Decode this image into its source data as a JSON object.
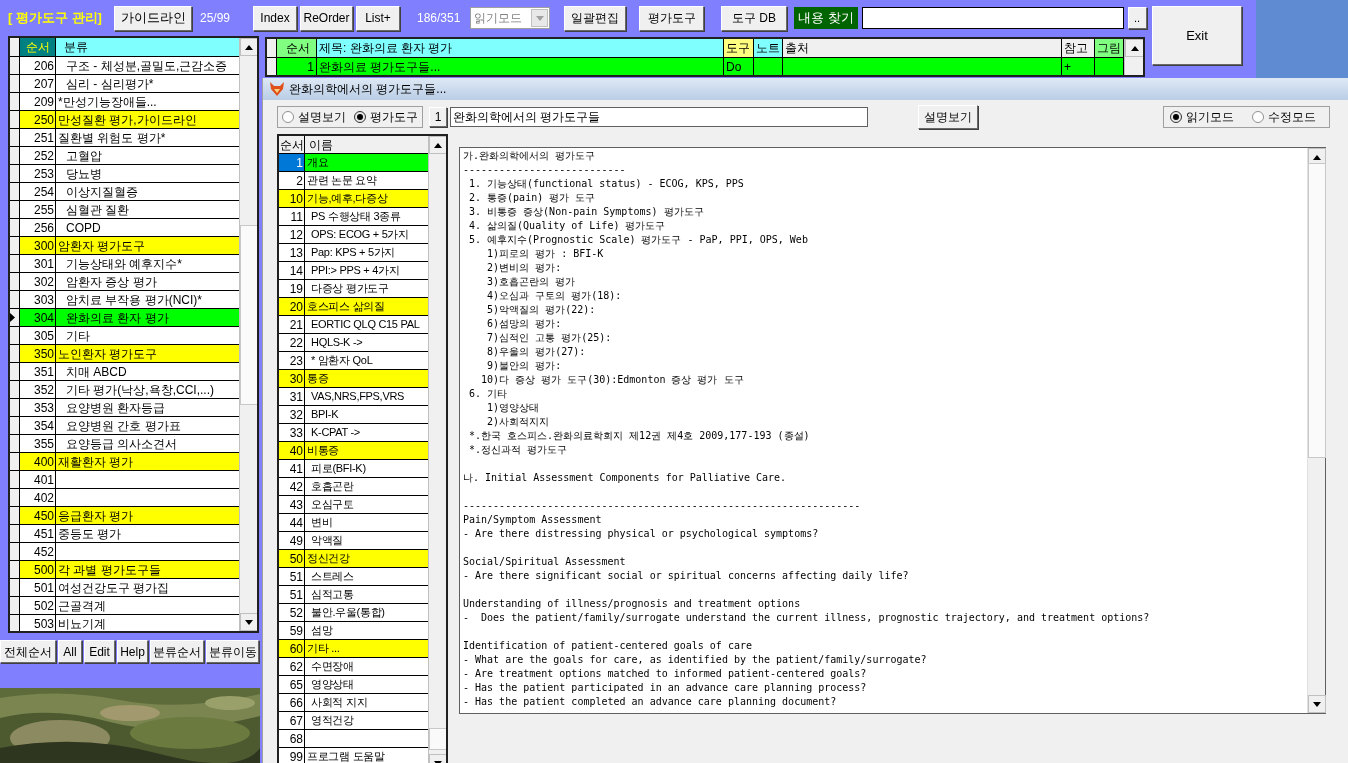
{
  "main_window": {
    "title": "[ 평가도구 관리]",
    "guideline_button": "가이드라인",
    "tool_counter": "25/99",
    "toolbar_buttons": [
      "Index",
      "ReOrder",
      "List+"
    ],
    "record_counter": "186/351",
    "mode_combo": {
      "value": "읽기모드",
      "disabled": true
    },
    "action_buttons": [
      "일괄편집",
      "평가도구",
      "도구 DB"
    ],
    "search": {
      "label": "내용 찾기"
    },
    "search_more_button": "..",
    "exit_button": "Exit"
  },
  "category_list": {
    "columns": [
      "순서",
      "분류"
    ],
    "rows": [
      {
        "order": "206",
        "label": "구조 - 체성분,골밀도,근감소증",
        "kind": "subitem",
        "selected": false
      },
      {
        "order": "207",
        "label": "심리 - 심리평가*",
        "kind": "subitem",
        "selected": false
      },
      {
        "order": "209",
        "label": "*만성기능장애들...",
        "kind": "item",
        "selected": false
      },
      {
        "order": "250",
        "label": "만성질환 평가,가이드라인",
        "kind": "group",
        "selected": false
      },
      {
        "order": "251",
        "label": "질환별 위험도 평가*",
        "kind": "item",
        "selected": false
      },
      {
        "order": "252",
        "label": "고혈압",
        "kind": "subitem",
        "selected": false
      },
      {
        "order": "253",
        "label": "당뇨병",
        "kind": "subitem",
        "selected": false
      },
      {
        "order": "254",
        "label": "이상지질혈증",
        "kind": "subitem",
        "selected": false
      },
      {
        "order": "255",
        "label": "심혈관 질환",
        "kind": "subitem",
        "selected": false
      },
      {
        "order": "256",
        "label": "COPD",
        "kind": "subitem",
        "selected": false
      },
      {
        "order": "300",
        "label": "암환자 평가도구",
        "kind": "group",
        "selected": false
      },
      {
        "order": "301",
        "label": "기능상태와 예후지수*",
        "kind": "subitem",
        "selected": false
      },
      {
        "order": "302",
        "label": "암환자 증상 평가",
        "kind": "subitem",
        "selected": false
      },
      {
        "order": "303",
        "label": "암치료 부작용 평가(NCI)*",
        "kind": "subitem",
        "selected": false
      },
      {
        "order": "304",
        "label": "완화의료 환자 평가",
        "kind": "subitem",
        "selected": true
      },
      {
        "order": "305",
        "label": "기타",
        "kind": "subitem",
        "selected": false
      },
      {
        "order": "350",
        "label": "노인환자 평가도구",
        "kind": "group",
        "selected": false
      },
      {
        "order": "351",
        "label": "치매 ABCD",
        "kind": "subitem",
        "selected": false
      },
      {
        "order": "352",
        "label": "기타 평가(낙상,욕창,CCI,...)",
        "kind": "subitem",
        "selected": false
      },
      {
        "order": "353",
        "label": "요양병원 환자등급",
        "kind": "subitem",
        "selected": false
      },
      {
        "order": "354",
        "label": "요양병원 간호 평가표",
        "kind": "subitem",
        "selected": false
      },
      {
        "order": "355",
        "label": "요양등급 의사소견서",
        "kind": "subitem",
        "selected": false
      },
      {
        "order": "400",
        "label": "재활환자 평가",
        "kind": "group",
        "selected": false
      },
      {
        "order": "401",
        "kind": "item",
        "selected": false
      },
      {
        "order": "402",
        "kind": "item",
        "selected": false
      },
      {
        "order": "450",
        "label": "응급환자 평가",
        "kind": "group",
        "selected": false
      },
      {
        "order": "451",
        "label": "중등도 평가",
        "kind": "item",
        "selected": false
      },
      {
        "order": "452",
        "kind": "item",
        "selected": false
      },
      {
        "order": "500",
        "label": "각 과별 평가도구들",
        "kind": "group",
        "selected": false
      },
      {
        "order": "501",
        "label": "여성건강도구 평가집",
        "kind": "item",
        "selected": false
      },
      {
        "order": "502",
        "label": "근골격계",
        "kind": "item",
        "selected": false
      },
      {
        "order": "503",
        "label": "비뇨기계",
        "kind": "item",
        "selected": false
      }
    ]
  },
  "bottom_buttons": [
    "전체순서",
    "All",
    "Edit",
    "Help",
    "분류순서",
    "분류이동"
  ],
  "background_photo": {
    "kind": "picture"
  },
  "record_grid": {
    "columns": [
      {
        "label": "순서",
        "color": "#80ff80"
      },
      {
        "label": "제목: 완화의료 환자 평가",
        "color": "#80ffff"
      },
      {
        "label": "도구",
        "color": "#ffff80"
      },
      {
        "label": "노트",
        "color": "#80ffff"
      },
      {
        "label": "출처",
        "color": "#f0f0f0"
      },
      {
        "label": "참고",
        "color": "#f0f0f0"
      },
      {
        "label": "그림",
        "color": "#80ff80"
      }
    ],
    "rows": [
      {
        "order": "1",
        "title": "완화의료 평가도구들...",
        "tool": "Do",
        "reference": "+",
        "selected": true
      }
    ]
  },
  "dialog": {
    "title": "완화의학에서의 평가도구들...",
    "view_radios": [
      {
        "label": "설명보기",
        "selected": false
      },
      {
        "label": "평가도구",
        "selected": true
      }
    ],
    "page_button": "1",
    "title_field": "완화의학에서의 평가도구들",
    "explain_button": "설명보기",
    "mode_radios": [
      {
        "label": "읽기모드",
        "selected": true
      },
      {
        "label": "수정모드",
        "selected": false
      }
    ],
    "item_list": {
      "columns": [
        "순서",
        "이름"
      ],
      "rows": [
        {
          "order": "1",
          "label": "개요",
          "kind": "item",
          "selected": true
        },
        {
          "order": "2",
          "label": "관련 논문 요약",
          "kind": "item",
          "selected": false
        },
        {
          "order": "10",
          "label": "기능,예후,다증상",
          "kind": "group",
          "selected": false
        },
        {
          "order": "11",
          "label": "PS 수행상태 3종류",
          "kind": "subitem",
          "selected": false
        },
        {
          "order": "12",
          "label": "OPS: ECOG + 5가지",
          "kind": "subitem",
          "selected": false
        },
        {
          "order": "13",
          "label": "Pap: KPS + 5가지",
          "kind": "subitem",
          "selected": false
        },
        {
          "order": "14",
          "label": "PPI:> PPS + 4가지",
          "kind": "subitem",
          "selected": false
        },
        {
          "order": "19",
          "label": "다증상 평가도구",
          "kind": "subitem",
          "selected": false
        },
        {
          "order": "20",
          "label": "호스피스 삶의질",
          "kind": "group",
          "selected": false
        },
        {
          "order": "21",
          "label": "EORTIC QLQ C15 PAL",
          "kind": "subitem",
          "selected": false
        },
        {
          "order": "22",
          "label": "HQLS-K ->",
          "kind": "subitem",
          "selected": false
        },
        {
          "order": "23",
          "label": "* 암환자 QoL",
          "kind": "subitem",
          "selected": false
        },
        {
          "order": "30",
          "label": "통증",
          "kind": "group",
          "selected": false
        },
        {
          "order": "31",
          "label": "VAS,NRS,FPS,VRS",
          "kind": "subitem",
          "selected": false
        },
        {
          "order": "32",
          "label": "BPI-K",
          "kind": "subitem",
          "selected": false
        },
        {
          "order": "33",
          "label": "K-CPAT ->",
          "kind": "subitem",
          "selected": false
        },
        {
          "order": "40",
          "label": "비통증",
          "kind": "group",
          "selected": false
        },
        {
          "order": "41",
          "label": "피로(BFI-K)",
          "kind": "subitem",
          "selected": false
        },
        {
          "order": "42",
          "label": "호흡곤란",
          "kind": "subitem",
          "selected": false
        },
        {
          "order": "43",
          "label": "오심구토",
          "kind": "subitem",
          "selected": false
        },
        {
          "order": "44",
          "label": "변비",
          "kind": "subitem",
          "selected": false
        },
        {
          "order": "49",
          "label": "악액질",
          "kind": "subitem",
          "selected": false
        },
        {
          "order": "50",
          "label": "정신건강",
          "kind": "group",
          "selected": false
        },
        {
          "order": "51",
          "label": "스트레스",
          "kind": "subitem",
          "selected": false
        },
        {
          "order": "51",
          "label": "심적고통",
          "kind": "subitem",
          "selected": false
        },
        {
          "order": "52",
          "label": "불안.우울(통합)",
          "kind": "subitem",
          "selected": false
        },
        {
          "order": "59",
          "label": "섬망",
          "kind": "subitem",
          "selected": false
        },
        {
          "order": "60",
          "label": "기타 ...",
          "kind": "group",
          "selected": false
        },
        {
          "order": "62",
          "label": "수면장애",
          "kind": "subitem",
          "selected": false
        },
        {
          "order": "65",
          "label": "영양상태",
          "kind": "subitem",
          "selected": false
        },
        {
          "order": "66",
          "label": "사회적 지지",
          "kind": "subitem",
          "selected": false
        },
        {
          "order": "67",
          "label": "영적건강",
          "kind": "subitem",
          "selected": false
        },
        {
          "order": "68",
          "kind": "item",
          "selected": false
        },
        {
          "order": "99",
          "label": "프로그램 도움말",
          "kind": "item",
          "selected": false
        }
      ]
    },
    "content": {
      "blocks": [
        [
          "가.완화의학에서의 평가도구",
          "---------------------------",
          " 1. 기능상태(functional status) - ECOG, KPS, PPS",
          " 2. 통증(pain) 평가 도구",
          " 3. 비통증 증상(Non-pain Symptoms) 평가도구",
          " 4. 삶의질(Quality of Life) 평가도구",
          " 5. 예후지수(Prognostic Scale) 평가도구 - PaP, PPI, OPS, Web",
          "    1)피로의 평가 : BFI-K",
          "    2)변비의 평가:",
          "    3)호흡곤란의 평가",
          "    4)오심과 구토의 평가(18):",
          "    5)악액질의 평가(22):",
          "    6)섬망의 평가:",
          "    7)심적인 고통 평가(25):",
          "    8)우울의 평가(27):",
          "    9)불안의 평가:",
          "   10)다 증상 평가 도구(30):Edmonton 증상 평가 도구",
          " 6. 기타",
          "    1)영양상태",
          "    2)사회적지지",
          " *.한국 호스피스.완화의료학회지 제12권 제4호 2009,177-193 (종설)",
          " *.정신과적 평가도구"
        ],
        [
          "나. Initial Assessment Components for Palliative Care."
        ],
        [
          "------------------------------------------------------------------",
          "Pain/Symptom Assessment",
          "- Are there distressing physical or psychological symptoms?"
        ],
        [
          "Social/Spiritual Assessment",
          "- Are there significant social or spiritual concerns affecting daily life?"
        ],
        [
          "Understanding of illness/prognosis and treatment options",
          "-  Does the patient/family/surrogate understand the current illness, prognostic trajectory, and treatment options?"
        ],
        [
          "Identification of patient-centered goals of care",
          "- What are the goals for care, as identified by the patient/family/surrogate?",
          "- Are treatment options matched to informed patient-centered goals?",
          "- Has the patient participated in an advance care planning process?",
          "- Has the patient completed an advance care planning document?"
        ]
      ]
    }
  }
}
